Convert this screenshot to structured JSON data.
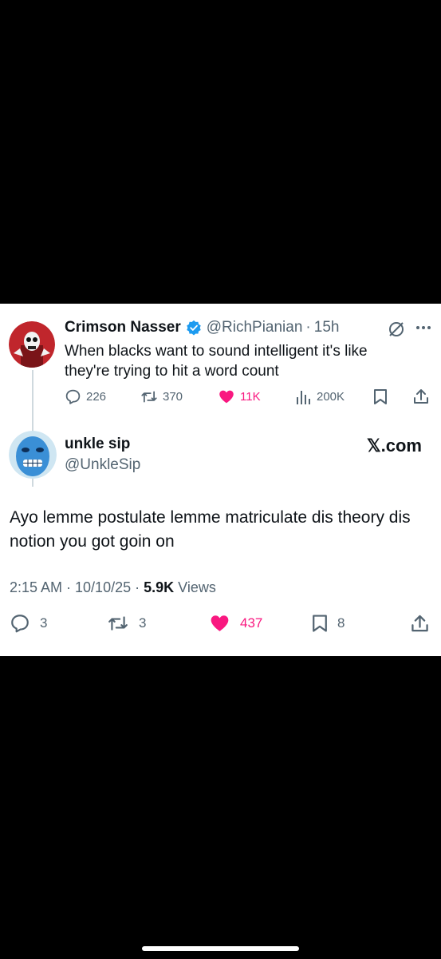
{
  "colors": {
    "background": "#000000",
    "card": "#ffffff",
    "verified": "#1d9bf0",
    "like": "#f91880",
    "muted": "#536471",
    "text": "#0f1419"
  },
  "quoted_tweet": {
    "display_name": "Crimson Nasser",
    "handle": "@RichPianian",
    "separator": "·",
    "time": "15h",
    "text": "When blacks want to sound intelligent it's like they're trying to hit a word count",
    "stats": {
      "replies": "226",
      "reposts": "370",
      "likes": "11K",
      "views": "200K"
    },
    "icons": [
      "verified-badge-icon",
      "grok-icon",
      "more-icon",
      "reply-icon",
      "repost-icon",
      "like-icon",
      "views-icon",
      "bookmark-icon",
      "share-icon"
    ]
  },
  "main_tweet": {
    "display_name": "unkle sip",
    "handle": "@UnkleSip",
    "brand": "𝕏.com",
    "text": "Ayo lemme postulate lemme matriculate dis theory dis notion you got goin on",
    "timestamp": "2:15 AM · 10/10/25 · ",
    "views_count": "5.9K",
    "views_label": " Views",
    "stats": {
      "replies": "3",
      "reposts": "3",
      "likes": "437",
      "bookmarks": "8"
    }
  }
}
